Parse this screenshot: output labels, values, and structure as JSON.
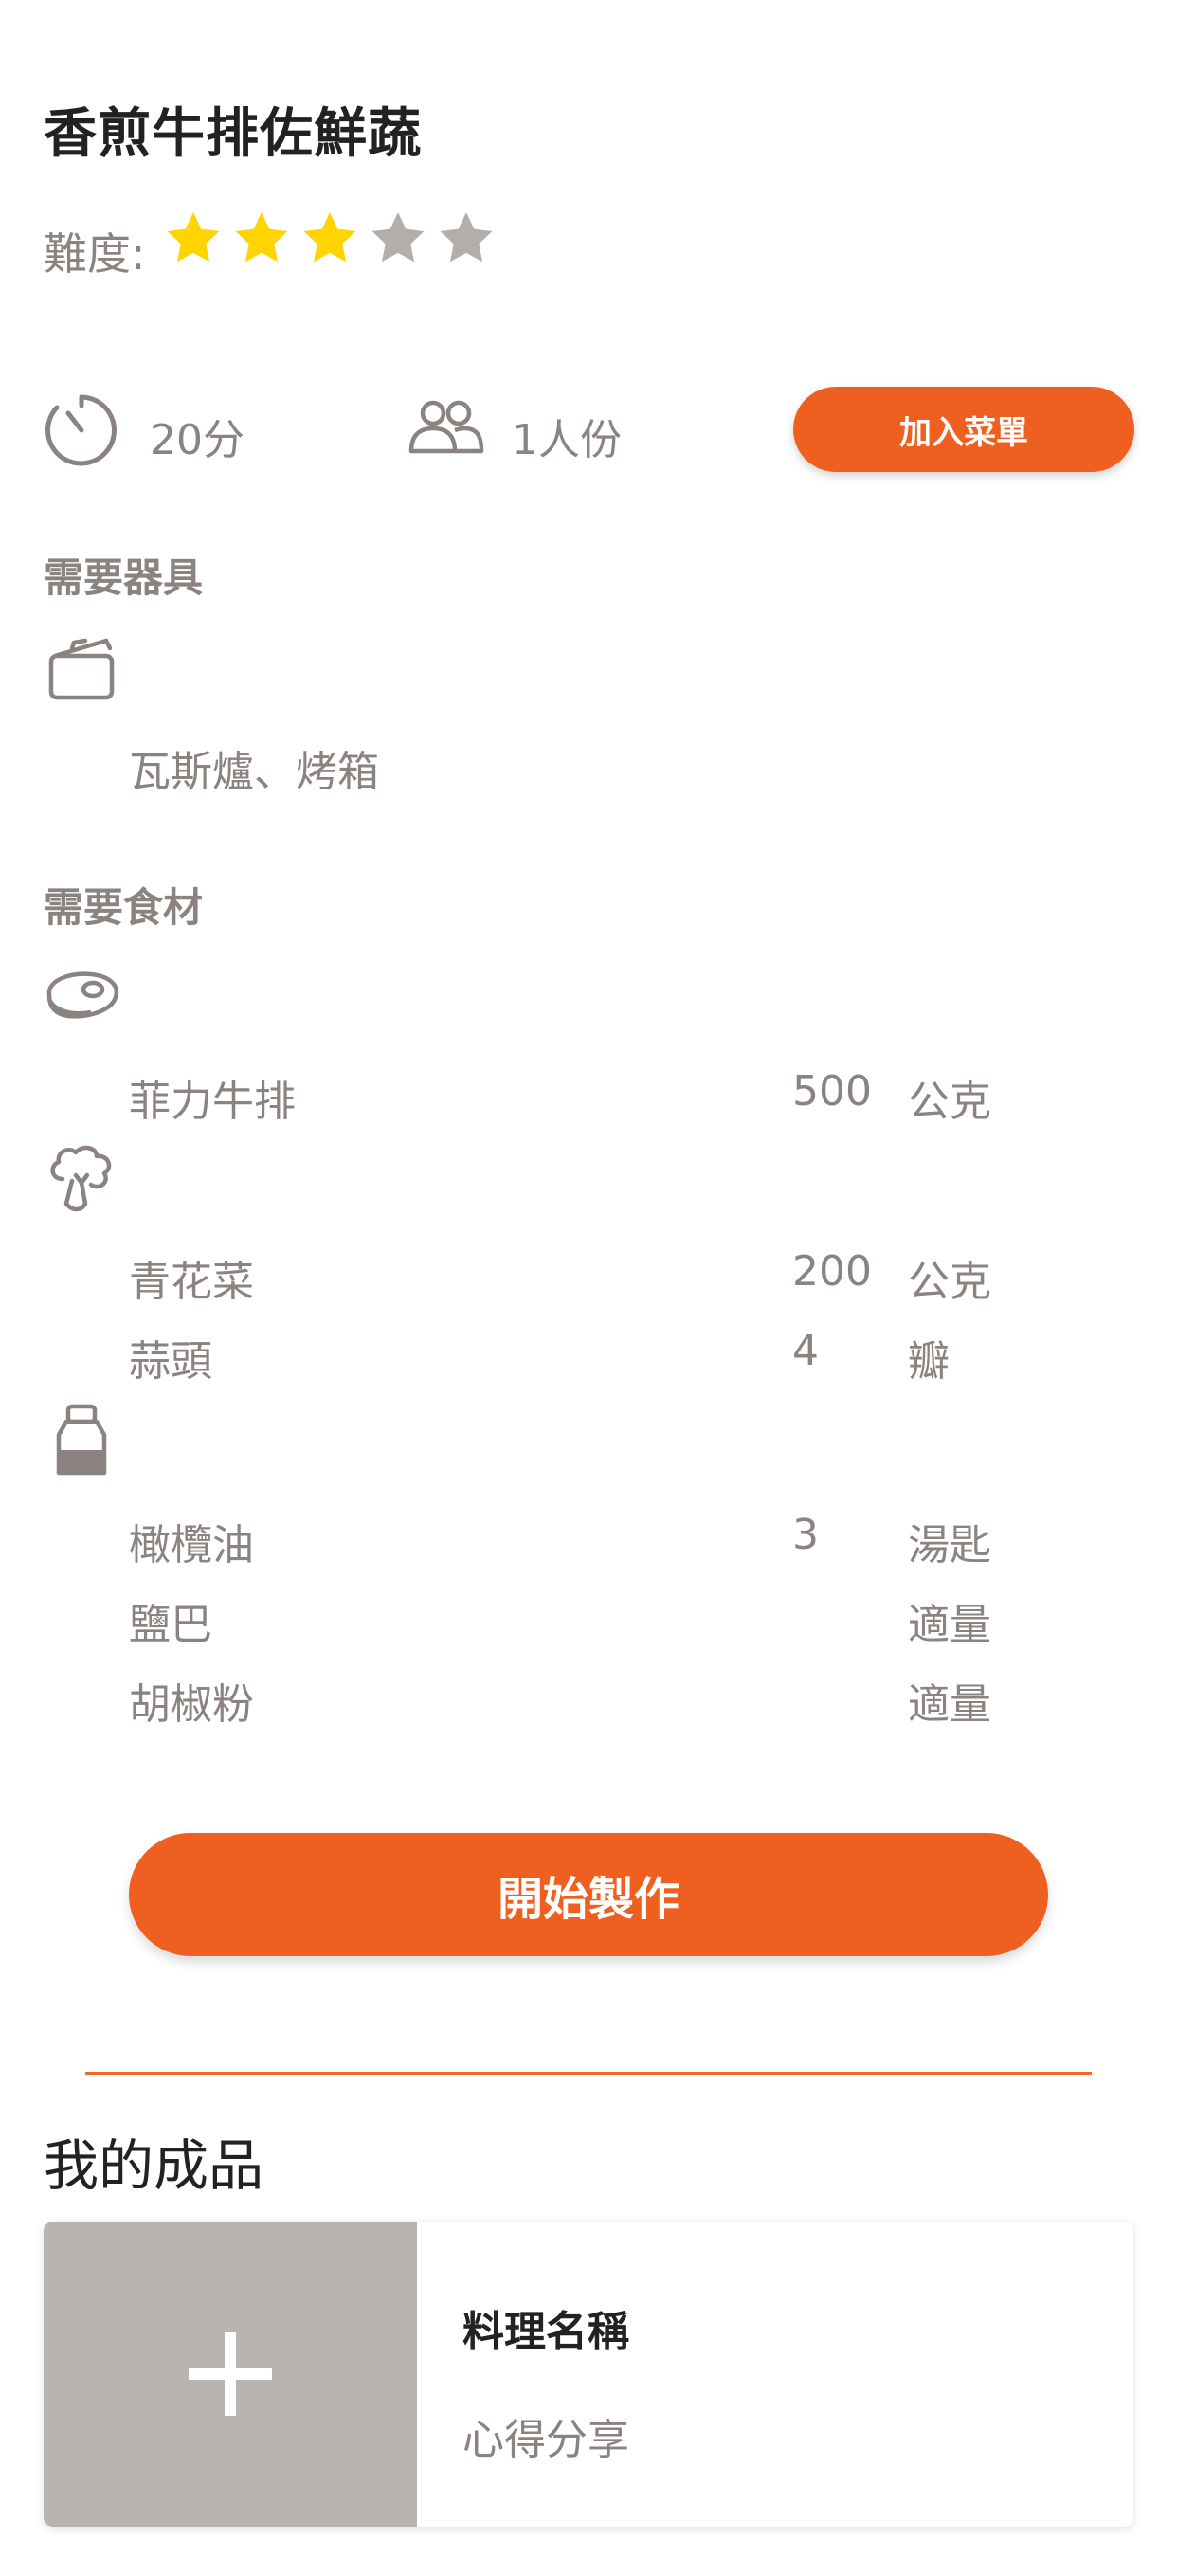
{
  "recipe": {
    "title": "香煎牛排佐鮮蔬",
    "difficulty_label": "難度:",
    "difficulty_rating": 3,
    "difficulty_max": 5
  },
  "info": {
    "time": "20分",
    "servings": "1人份",
    "add_menu_label": "加入菜單"
  },
  "equipment": {
    "title": "需要器具",
    "icon": "pot-icon",
    "items": "瓦斯爐、烤箱"
  },
  "ingredients": {
    "title": "需要食材",
    "groups": [
      {
        "icon": "meat-icon",
        "items": [
          {
            "name": "菲力牛排",
            "qty": "500",
            "unit": "公克"
          }
        ]
      },
      {
        "icon": "broccoli-icon",
        "items": [
          {
            "name": "青花菜",
            "qty": "200",
            "unit": "公克"
          },
          {
            "name": "蒜頭",
            "qty": "4",
            "unit": "瓣"
          }
        ]
      },
      {
        "icon": "seasoning-icon",
        "items": [
          {
            "name": "橄欖油",
            "qty": "3",
            "unit": "湯匙"
          },
          {
            "name": "鹽巴",
            "qty": "",
            "unit": "適量"
          },
          {
            "name": "胡椒粉",
            "qty": "",
            "unit": "適量"
          }
        ]
      }
    ]
  },
  "start_button_label": "開始製作",
  "my_works": {
    "title": "我的成品",
    "card_name": "料理名稱",
    "card_share": "心得分享"
  },
  "colors": {
    "accent": "#ef5f1f",
    "star_active": "#ffd400",
    "star_inactive": "#b3aeab",
    "text_muted": "#8a8380"
  }
}
